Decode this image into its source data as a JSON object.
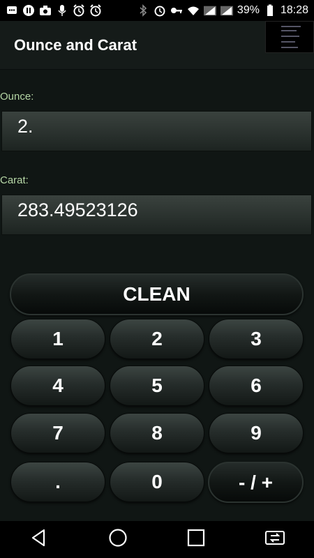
{
  "status_bar": {
    "battery_percent": "39%",
    "time": "18:28",
    "left_icons": [
      "message-icon",
      "pause-icon",
      "camera-icon",
      "mic-icon",
      "alarm-icon",
      "alarm-icon"
    ],
    "right_icons": [
      "bluetooth-icon",
      "alarm-icon",
      "key-icon",
      "wifi-icon",
      "signal-icon",
      "signal-icon",
      "battery-icon"
    ]
  },
  "app_bar": {
    "title": "Ounce and Carat"
  },
  "converter": {
    "ounce_label": "Ounce:",
    "ounce_value": "2.",
    "carat_label": "Carat:",
    "carat_value": "283.49523126"
  },
  "keypad": {
    "clean": "CLEAN",
    "k1": "1",
    "k2": "2",
    "k3": "3",
    "k4": "4",
    "k5": "5",
    "k6": "6",
    "k7": "7",
    "k8": "8",
    "k9": "9",
    "kdot": ".",
    "k0": "0",
    "ksign": "- / +"
  },
  "nav_bar": {
    "icons": [
      "back-icon",
      "home-icon",
      "recents-icon",
      "switch-sim-icon"
    ]
  },
  "colors": {
    "label": "#b6d7a6",
    "background": "#101614"
  }
}
